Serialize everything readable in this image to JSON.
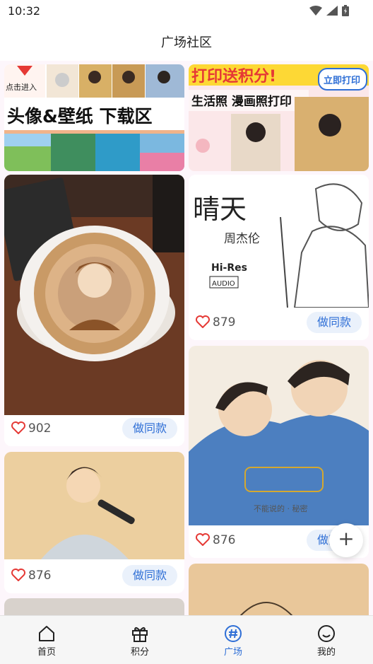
{
  "status_bar": {
    "time": "10:32"
  },
  "header": {
    "title": "广场社区"
  },
  "banners": [
    {
      "tag": "点击进入",
      "title": "头像&壁纸 下载区"
    },
    {
      "title": "打印送积分!",
      "badge": "立即打印",
      "subtitle": "生活照 漫画照打印"
    }
  ],
  "cards": [
    {
      "likes": "902",
      "button": "做同款",
      "art_text": ""
    },
    {
      "likes": "876",
      "button": "做同款",
      "art_text": ""
    },
    {
      "likes": "879",
      "button": "做同款",
      "art_title": "晴天",
      "art_artist": "周杰伦",
      "art_badge_1": "Hi-Res",
      "art_badge_2": "AUDIO"
    },
    {
      "likes": "876",
      "button": "做同款",
      "art_caption": "不能说的 · 秘密"
    }
  ],
  "fab": {
    "label": "+"
  },
  "nav": {
    "items": [
      {
        "label": "首页",
        "icon": "home-icon"
      },
      {
        "label": "积分",
        "icon": "gift-icon"
      },
      {
        "label": "广场",
        "icon": "hashtag-icon"
      },
      {
        "label": "我的",
        "icon": "smile-icon"
      }
    ],
    "active_index": 2
  },
  "colors": {
    "accent": "#2f6fd6",
    "like": "#e53935",
    "button_bg": "#eaf1fb"
  }
}
